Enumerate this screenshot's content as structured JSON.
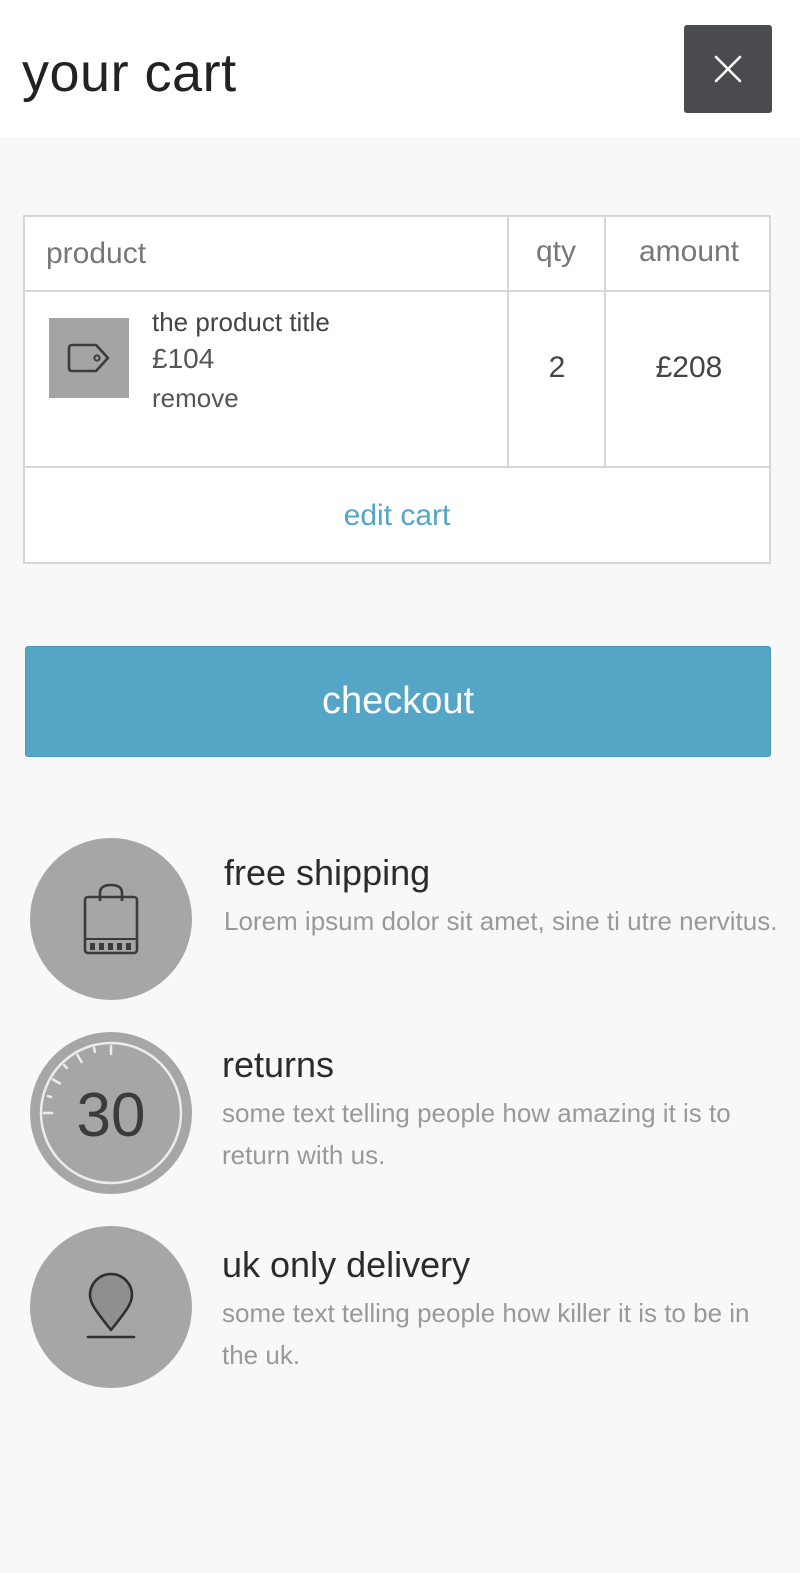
{
  "header": {
    "title": "your cart",
    "close_icon": "close-icon"
  },
  "table": {
    "columns": [
      "product",
      "qty",
      "amount"
    ],
    "rows": [
      {
        "icon": "price-tag-icon",
        "title": "the product title",
        "price": "£104",
        "remove_label": "remove",
        "qty": "2",
        "amount": "£208"
      }
    ],
    "edit_label": "edit cart"
  },
  "checkout_label": "checkout",
  "features": [
    {
      "icon": "shopping-bag-icon",
      "title": "free shipping",
      "description": "Lorem ipsum dolor sit amet, sine ti utre nervitus."
    },
    {
      "icon": "30-day-badge-icon",
      "badge_text": "30",
      "title": "returns",
      "description": "some text telling people how amazing it is to return with us."
    },
    {
      "icon": "map-pin-icon",
      "title": "uk only delivery",
      "description": "some text telling people how killer it is to be in the uk."
    }
  ],
  "colors": {
    "accent": "#55a5c7",
    "close_bg": "#4a4b4f",
    "icon_circle": "#a6a6a6",
    "page_bg": "#f8f8f8"
  }
}
